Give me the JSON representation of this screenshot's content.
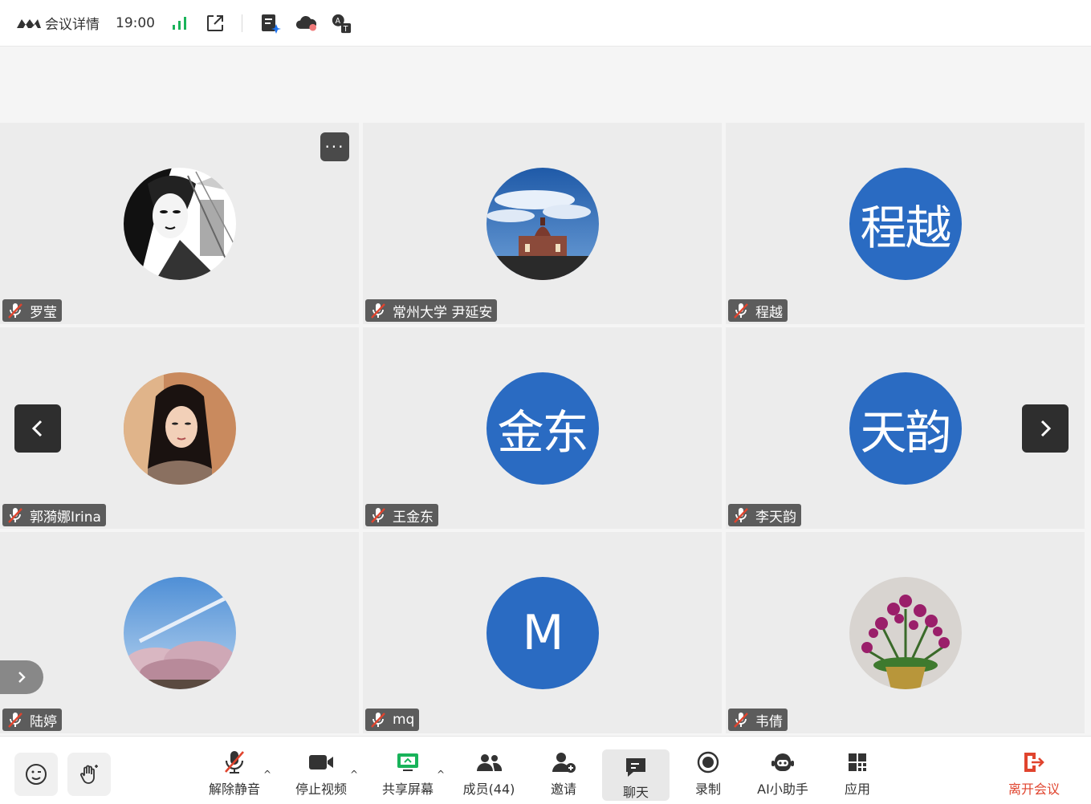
{
  "header": {
    "meeting_details": "会议详情",
    "time": "19:00",
    "icons": [
      "logo-icon",
      "signal-icon",
      "popout-icon",
      "notes-ai-icon",
      "cloud-record-icon",
      "translate-icon"
    ]
  },
  "participants": [
    {
      "name": "罗莹",
      "avatar_type": "photo",
      "avatar_desc": "sketch-portrait"
    },
    {
      "name": "常州大学 尹延安",
      "avatar_type": "photo",
      "avatar_desc": "sky-building"
    },
    {
      "name": "程越",
      "avatar_type": "text",
      "avatar_text": "程越"
    },
    {
      "name": "郭漪娜Irina",
      "avatar_type": "photo",
      "avatar_desc": "woman-portrait"
    },
    {
      "name": "王金东",
      "avatar_type": "text",
      "avatar_text": "金东"
    },
    {
      "name": "李天韵",
      "avatar_type": "text",
      "avatar_text": "天韵"
    },
    {
      "name": "陆婷",
      "avatar_type": "photo",
      "avatar_desc": "blossom-sky"
    },
    {
      "name": "mq",
      "avatar_type": "text",
      "avatar_text": "M"
    },
    {
      "name": "韦倩",
      "avatar_type": "photo",
      "avatar_desc": "orchid-pot"
    }
  ],
  "more_label": "···",
  "toolbar": {
    "unmute": "解除静音",
    "stop_video": "停止视频",
    "share_screen": "共享屏幕",
    "members": "成员(44)",
    "invite": "邀请",
    "chat": "聊天",
    "record": "录制",
    "ai_assistant": "AI小助手",
    "apps": "应用",
    "leave": "离开会议",
    "caret": "^"
  },
  "colors": {
    "avatar_blue": "#2a6bc2",
    "leave_red": "#e0442e",
    "signal_green": "#19b35a",
    "share_green": "#19b35a"
  }
}
